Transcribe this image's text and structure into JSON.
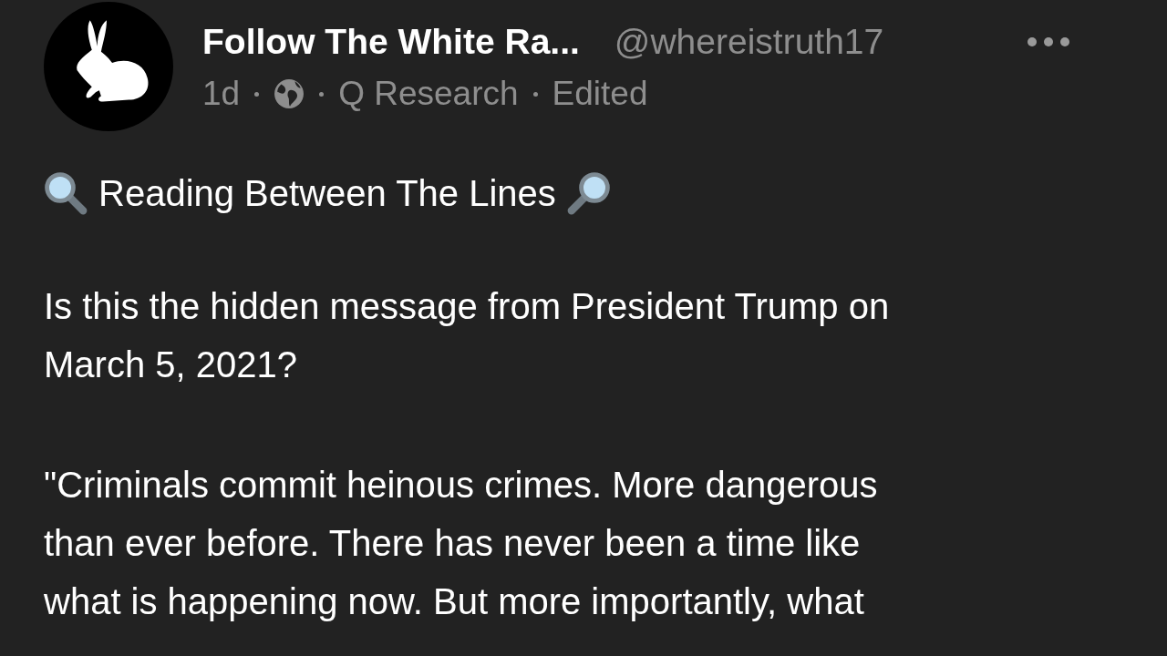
{
  "post": {
    "author": "Follow The White Ra...",
    "handle": "@whereistruth17",
    "time": "1d",
    "group": "Q Research",
    "edited": "Edited",
    "title": "Reading Between The Lines",
    "paragraphs": [
      "Is this the hidden message from President Trump on\nMarch 5, 2021?",
      "\"Criminals commit heinous crimes. More dangerous\nthan ever before. There has never been a time like\nwhat is happening now. But more importantly, what"
    ]
  }
}
